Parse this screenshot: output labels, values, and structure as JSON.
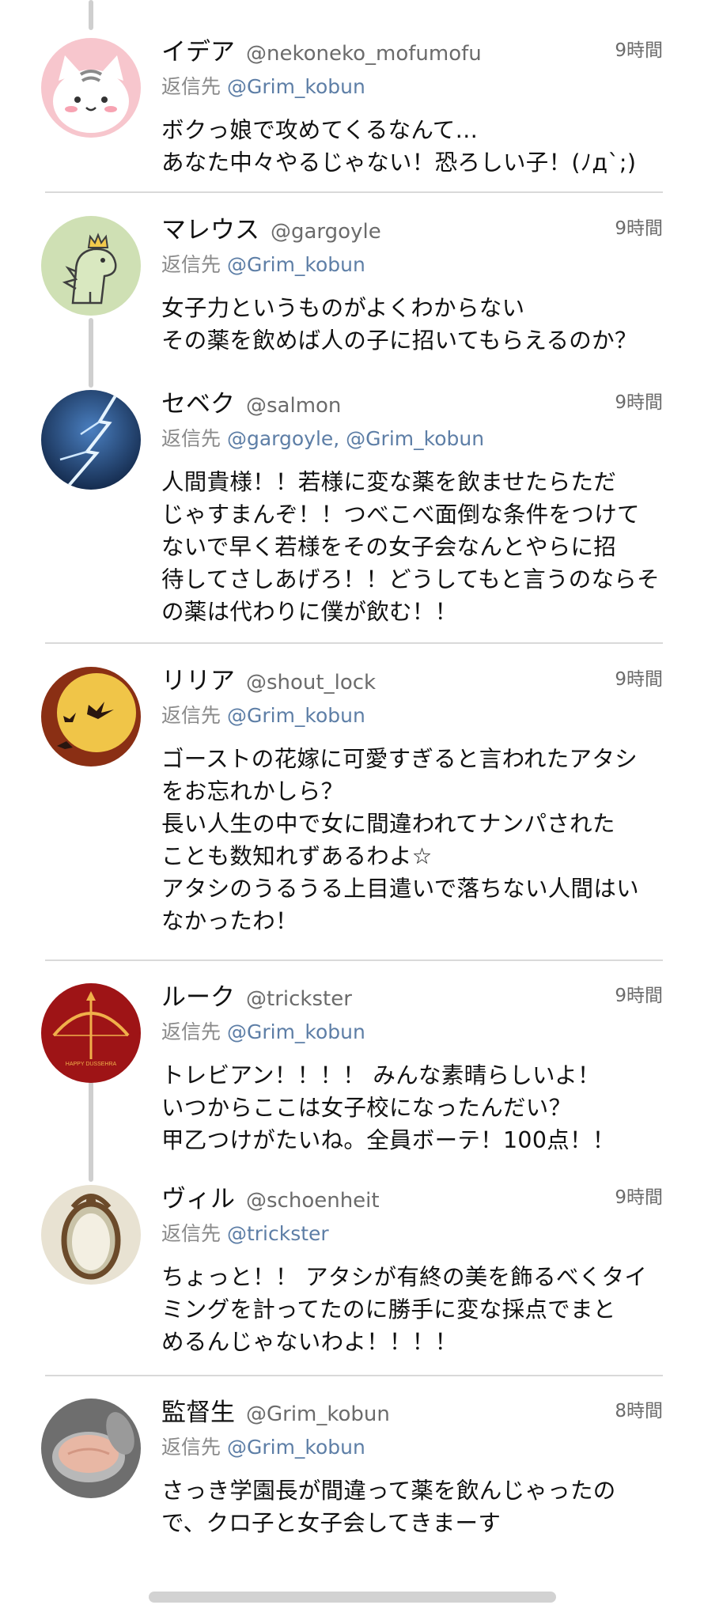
{
  "tweets": [
    {
      "name": "イデア",
      "handle": "@nekoneko_mofumofu",
      "time": "9時間",
      "reply_prefix": "返信先",
      "reply_to": "@Grim_kobun",
      "text": "ボクっ娘で攻めてくるなんて…\nあなた中々やるじゃない！恐ろしい子！(ﾉд`;)",
      "avatar_icon": "cat-avatar-icon"
    },
    {
      "name": "マレウス",
      "handle": "@gargoyle",
      "time": "9時間",
      "reply_prefix": "返信先",
      "reply_to": "@Grim_kobun",
      "text": "女子力というものがよくわからない\nその薬を飲めば人の子に招いてもらえるのか？",
      "avatar_icon": "dinosaur-crown-avatar-icon"
    },
    {
      "name": "セベク",
      "handle": "@salmon",
      "time": "9時間",
      "reply_prefix": "返信先",
      "reply_to": "@gargoyle, @Grim_kobun",
      "text": "人間貴様！！若様に変な薬を飲ませたらただ\nじゃすまんぞ！！つべこべ面倒な条件をつけて\nないで早く若様をその女子会なんとやらに招\n待してさしあげろ！！どうしてもと言うのならそ\nの薬は代わりに僕が飲む！！",
      "avatar_icon": "lightning-avatar-icon"
    },
    {
      "name": "リリア",
      "handle": "@shout_lock",
      "time": "9時間",
      "reply_prefix": "返信先",
      "reply_to": "@Grim_kobun",
      "text": "ゴーストの花嫁に可愛すぎると言われたアタシ\nをお忘れかしら？\n長い人生の中で女に間違われてナンパされた\nことも数知れずあるわよ☆\nアタシのうるうる上目遣いで落ちない人間はい\nなかったわ！",
      "avatar_icon": "moon-bats-avatar-icon"
    },
    {
      "name": "ルーク",
      "handle": "@trickster",
      "time": "9時間",
      "reply_prefix": "返信先",
      "reply_to": "@Grim_kobun",
      "text": "トレビアン！！！！ みんな素晴らしいよ！\nいつからここは女子校になったんだい？\n甲乙つけがたいね。全員ボーテ！100点！！",
      "avatar_icon": "bow-arrow-avatar-icon",
      "avatar_text": "HAPPY DUSSEHRA"
    },
    {
      "name": "ヴィル",
      "handle": "@schoenheit",
      "time": "9時間",
      "reply_prefix": "返信先",
      "reply_to": "@trickster",
      "text": "ちょっと！！ アタシが有終の美を飾るべくタイ\nミングを計ってたのに勝手に変な採点でまと\nめるんじゃないわよ！！！！",
      "avatar_icon": "ornate-mirror-avatar-icon"
    },
    {
      "name": "監督生",
      "handle": "@Grim_kobun",
      "time": "8時間",
      "reply_prefix": "返信先",
      "reply_to": "@Grim_kobun",
      "text": "さっき学園長が間違って薬を飲んじゃったの\nで、クロ子と女子会してきまーす",
      "avatar_icon": "tuna-can-avatar-icon"
    }
  ],
  "colors": {
    "link": "#5d7ea6",
    "muted": "#6b6b6b",
    "divider": "#d9d9d9",
    "thread": "#cfcfcf"
  }
}
